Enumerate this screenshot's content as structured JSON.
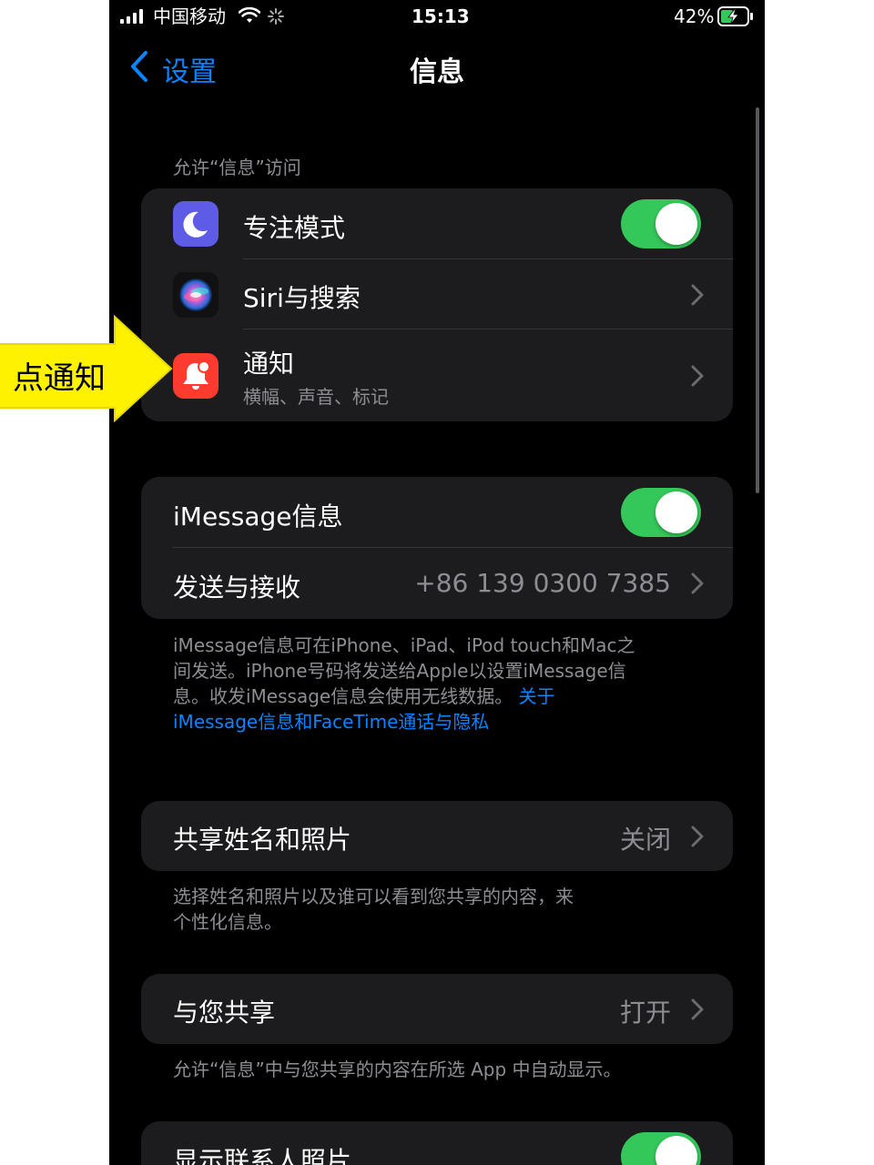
{
  "status_bar": {
    "carrier": "中国移动",
    "time": "15:13",
    "battery": "42%"
  },
  "nav": {
    "back_label": "设置",
    "title": "信息"
  },
  "section_allow": {
    "header": "允许“信息”访问",
    "rows": [
      {
        "label": "专注模式",
        "icon": "moon-icon",
        "control": "toggle-on"
      },
      {
        "label": "Siri与搜索",
        "icon": "siri-icon",
        "control": "chevron"
      },
      {
        "label": "通知",
        "sublabel": "横幅、声音、标记",
        "icon": "bell-icon",
        "control": "chevron"
      }
    ]
  },
  "section_imessage": {
    "rows": [
      {
        "label": "iMessage信息",
        "control": "toggle-on"
      },
      {
        "label": "发送与接收",
        "value": "+86 139 0300 7385",
        "control": "chevron"
      }
    ],
    "footer_text": "iMessage信息可在iPhone、iPad、iPod touch和Mac之间发送。iPhone号码将发送给Apple以设置iMessage信息。收发iMessage信息会使用无线数据。",
    "footer_link_1": "关于",
    "footer_link_2": "iMessage信息和FaceTime通话与隐私",
    "footer_line1": "iMessage信息可在iPhone、iPad、iPod touch和Mac之",
    "footer_line2": "间发送。iPhone号码将发送给Apple以设置iMessage信",
    "footer_line3": "息。收发iMessage信息会使用无线数据。"
  },
  "section_share_name": {
    "label": "共享姓名和照片",
    "value": "关闭",
    "footer_line1": "选择姓名和照片以及谁可以看到您共享的内容，来",
    "footer_line2": "个性化信息。"
  },
  "section_shared_with_you": {
    "label": "与您共享",
    "value": "打开",
    "footer": "允许“信息”中与您共享的内容在所选 App 中自动显示。"
  },
  "section_contact_photos": {
    "label": "显示联系人照片",
    "control": "toggle-on"
  },
  "annotation": {
    "text": "点通知",
    "color": "#fff200"
  },
  "colors": {
    "toggle_on": "#34c759",
    "link": "#0a84ff",
    "cell_bg": "#1c1c1e",
    "notification_icon": "#ff3b30",
    "focus_icon": "#5e5ce6"
  }
}
